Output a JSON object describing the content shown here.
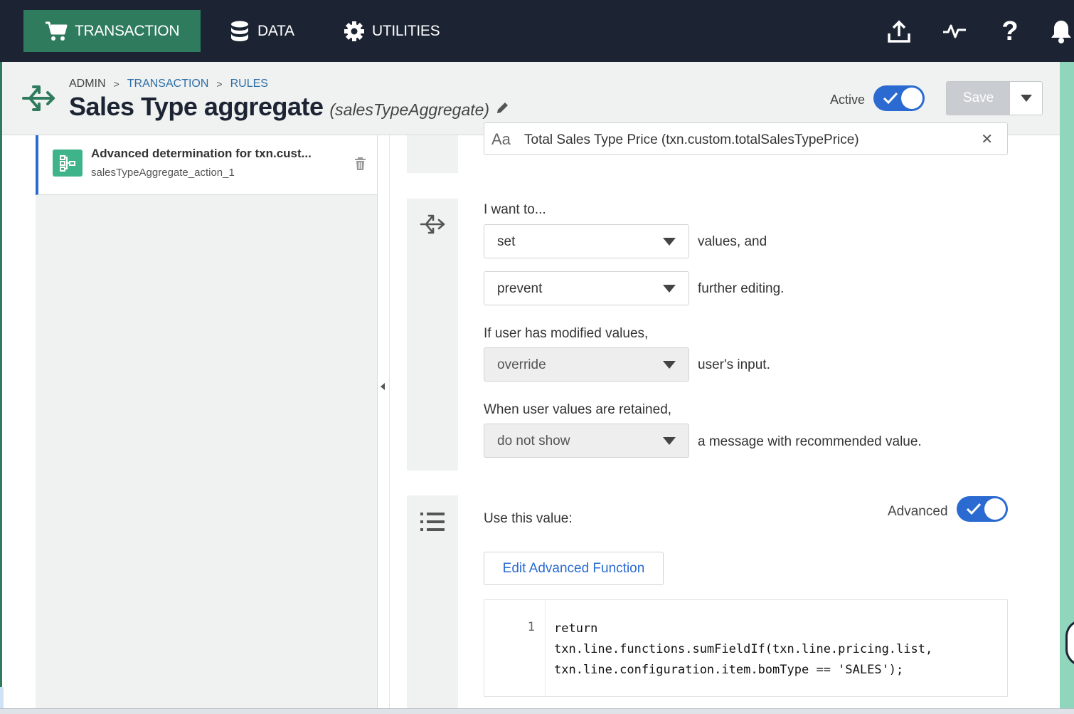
{
  "nav": {
    "transaction": "TRANSACTION",
    "data": "DATA",
    "utilities": "UTILITIES",
    "icons": [
      "upload-icon",
      "activity-icon",
      "help-icon",
      "bell-icon"
    ],
    "help_glyph": "?"
  },
  "header": {
    "breadcrumb": [
      "ADMIN",
      "TRANSACTION",
      "RULES"
    ],
    "breadcrumb_sep": ">",
    "title": "Sales Type aggregate",
    "variable_name": "(salesTypeAggregate)",
    "active_label": "Active",
    "active": true,
    "save_label": "Save"
  },
  "sidebar": {
    "action_title": "Advanced determination for txn.cust...",
    "action_sub": "salesTypeAggregate_action_1"
  },
  "main": {
    "target_field_glyph": "Aa",
    "target_field": "Total Sales Type Price (txn.custom.totalSalesTypePrice)",
    "clear_glyph": "✕",
    "want_label": "I want to...",
    "action_select": "set",
    "action_suffix": "values, and",
    "edit_select": "prevent",
    "edit_suffix": "further editing.",
    "modified_label": "If user has modified values,",
    "override_select": "override",
    "override_suffix": "user's input.",
    "retained_label": "When user values are retained,",
    "show_select": "do not show",
    "show_suffix": "a message with recommended value.",
    "use_value_label": "Use this value:",
    "advanced_label": "Advanced",
    "advanced": true,
    "edit_function_label": "Edit Advanced Function",
    "code_line_number": "1",
    "code": "return\ntxn.line.functions.sumFieldIf(txn.line.pricing.list,\ntxn.line.configuration.item.bomType == 'SALES');"
  },
  "colors": {
    "nav_bg": "#1c2434",
    "nav_active": "#2f7b5e",
    "toggle_blue": "#2b6bd1",
    "rule_green": "#3fb48a",
    "link_blue": "#2c6fa8"
  }
}
